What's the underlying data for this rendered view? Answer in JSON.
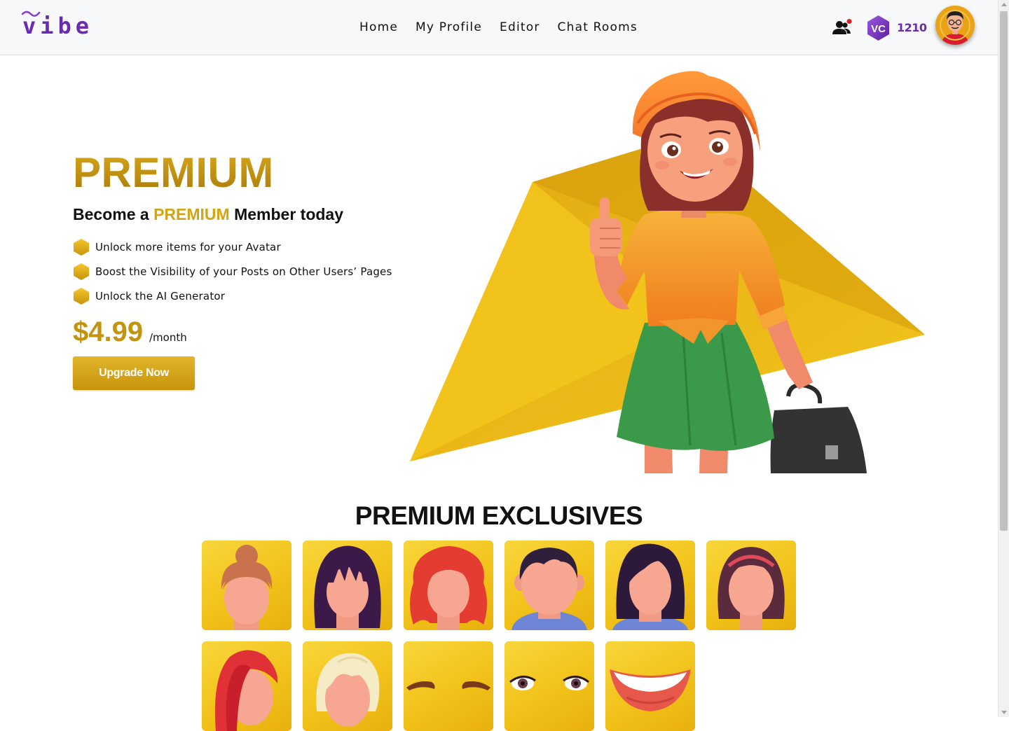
{
  "app": {
    "logo_text": "vibe",
    "brand_color": "#6b2bb0"
  },
  "nav": {
    "items": [
      {
        "label": "Home"
      },
      {
        "label": "My Profile"
      },
      {
        "label": "Editor"
      },
      {
        "label": "Chat Rooms"
      }
    ]
  },
  "header": {
    "friends_icon": "friends-icon",
    "has_notification": true,
    "vc_badge_label": "VC",
    "vc_count": "1210"
  },
  "hero": {
    "title": "PREMIUM",
    "subtitle_before": "Become a ",
    "subtitle_accent": "PREMIUM",
    "subtitle_after": " Member today",
    "features": [
      {
        "text": "Unlock more items for your Avatar"
      },
      {
        "text": "Boost the Visibility of your Posts on Other Users’ Pages"
      },
      {
        "text": "Unlock the AI Generator"
      }
    ],
    "price": "$4.99",
    "period": "/month",
    "cta_label": "Upgrade Now",
    "accent_color": "#d4a414"
  },
  "exclusives": {
    "title": "PREMIUM EXCLUSIVES",
    "items": [
      {
        "name": "hair-bun"
      },
      {
        "name": "hair-long-bangs"
      },
      {
        "name": "hair-red-wavy"
      },
      {
        "name": "hair-short-male"
      },
      {
        "name": "hair-long-straight"
      },
      {
        "name": "hair-headband"
      },
      {
        "name": "hair-red-side"
      },
      {
        "name": "hair-blonde-short"
      },
      {
        "name": "eyebrows"
      },
      {
        "name": "eyes"
      },
      {
        "name": "mouth-smile"
      }
    ]
  }
}
